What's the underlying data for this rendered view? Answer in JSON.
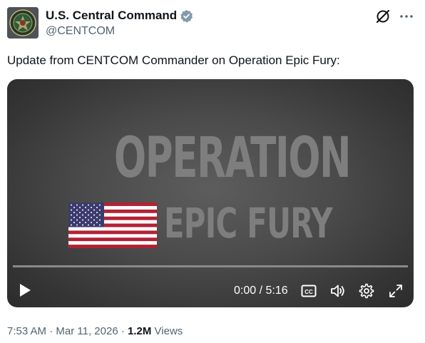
{
  "author": {
    "display_name": "U.S. Central Command",
    "handle": "@CENTCOM",
    "verified": true,
    "verified_color": "#829aab"
  },
  "icons": {
    "grok": "grok-icon",
    "more": "more-icon"
  },
  "tweet": {
    "text": "Update from CENTCOM Commander on Operation Epic Fury:"
  },
  "video": {
    "title_line1": "OPERATION",
    "title_line2": "EPIC FURY",
    "time": "0:00 / 5:16",
    "progress": 0,
    "controls": [
      "play-icon",
      "closed-captions-icon",
      "volume-icon",
      "settings-icon",
      "fullscreen-icon"
    ]
  },
  "meta": {
    "time": "7:53 AM",
    "separator1": " · ",
    "date": "Mar 11, 2026",
    "separator2": " · ",
    "views_count": "1.2M",
    "views_label": " Views"
  },
  "colors": {
    "text_primary": "#0f1419",
    "text_secondary": "#536471",
    "video_bg": "#4a4a4a"
  }
}
